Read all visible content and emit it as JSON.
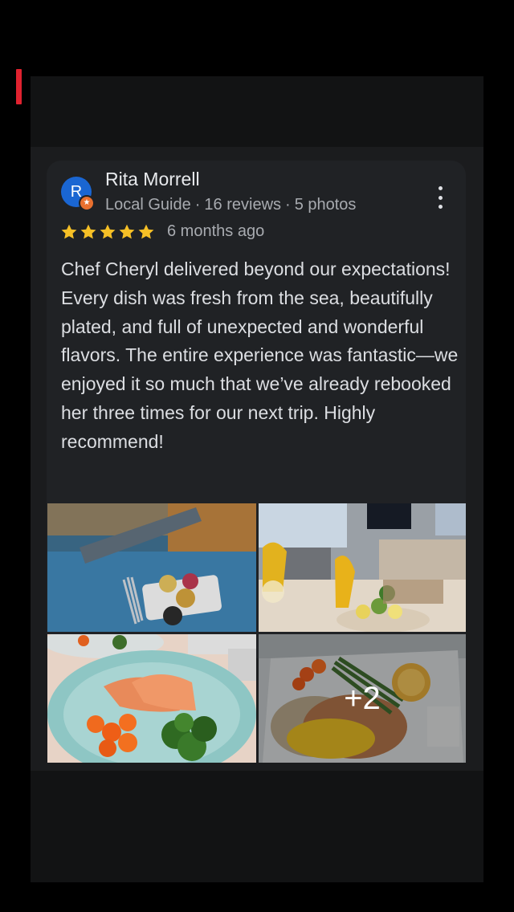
{
  "reviewer": {
    "avatar_initial": "R",
    "name": "Rita Morrell",
    "badge": "Local Guide",
    "reviews_count": "16 reviews",
    "photos_count": "5 photos",
    "separator": "·"
  },
  "review": {
    "rating": 5,
    "rating_max": 5,
    "star_color": "#f6c026",
    "time_ago": "6 months ago",
    "text": "Chef Cheryl delivered beyond our expectations! Every dish was fresh from the sea, beautifully plated, and full of unexpected and wonderful flavors. The entire experience was fantastic—we enjoyed it so much that we’ve already rebooked her three times for our next trip. Highly recommend!"
  },
  "photos": {
    "more_label": "+2"
  },
  "icons": {
    "menu": "more-vert-icon",
    "badge": "local-guide-icon",
    "star": "star-icon"
  },
  "colors": {
    "accent_red": "#e0222f",
    "avatar_blue": "#1a66d2",
    "badge_orange": "#e9702f"
  }
}
